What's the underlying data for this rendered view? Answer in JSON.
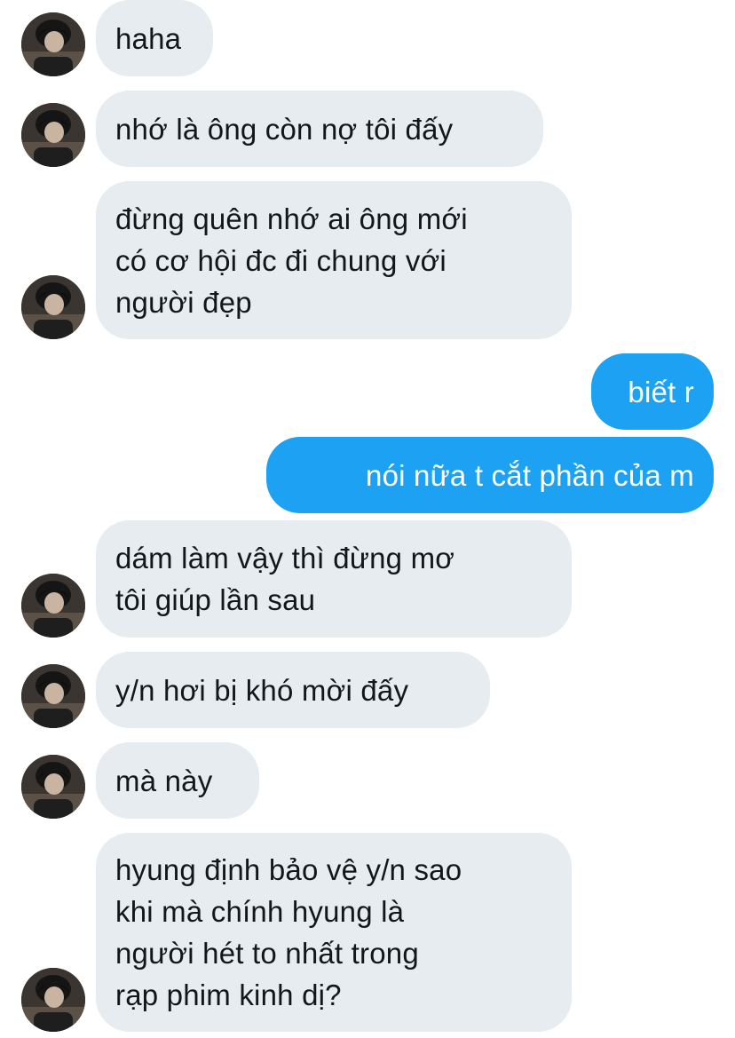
{
  "conversation": {
    "messages": [
      {
        "side": "in",
        "lines": [
          "haha"
        ]
      },
      {
        "side": "in",
        "lines": [
          "nhớ là ông còn nợ tôi đấy"
        ]
      },
      {
        "side": "in",
        "lines": [
          "đừng quên nhớ ai ông mới",
          "có cơ hội đc đi chung với",
          "người đẹp"
        ]
      },
      {
        "side": "out",
        "lines": [
          "biết r"
        ]
      },
      {
        "side": "out",
        "lines": [
          "nói nữa t cắt phần của m"
        ]
      },
      {
        "side": "in",
        "lines": [
          "dám làm vậy thì đừng mơ",
          "tôi giúp lần sau"
        ]
      },
      {
        "side": "in",
        "lines": [
          "y/n hơi bị khó mời đấy"
        ]
      },
      {
        "side": "in",
        "lines": [
          "mà này"
        ]
      },
      {
        "side": "in",
        "lines": [
          "hyung định bảo vệ y/n sao",
          "khi mà chính hyung là",
          "người hét to nhất trong",
          "rạp phim kinh dị?"
        ]
      }
    ]
  },
  "colors": {
    "incoming_bubble": "#e6ecf0",
    "outgoing_bubble": "#1da1f2",
    "incoming_text": "#14171a",
    "outgoing_text": "#ffffff"
  },
  "icons": {
    "avatar": "contact-avatar-photo"
  }
}
